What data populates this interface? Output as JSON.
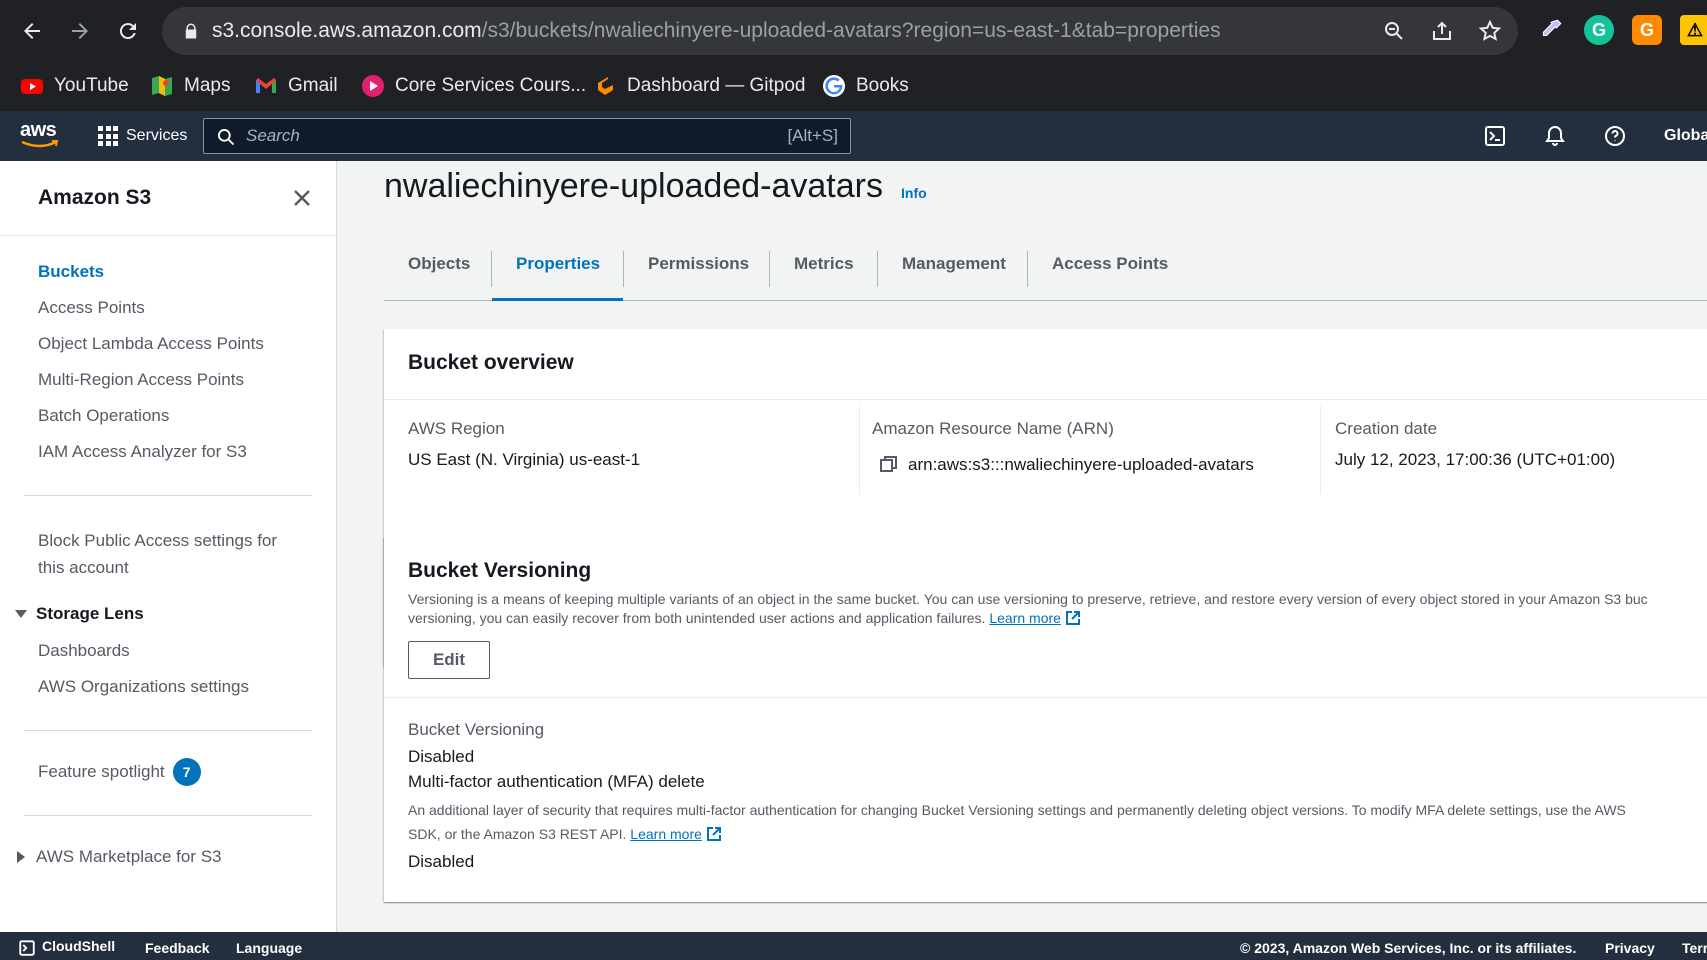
{
  "browser": {
    "url_host": "s3.console.aws.amazon.com",
    "url_path": "/s3/buckets/nwaliechinyere-uploaded-avatars?region=us-east-1&tab=properties",
    "bookmarks": [
      {
        "label": "YouTube",
        "icon": "youtube-icon"
      },
      {
        "label": "Maps",
        "icon": "maps-icon"
      },
      {
        "label": "Gmail",
        "icon": "gmail-icon"
      },
      {
        "label": "Core Services Cours...",
        "icon": "core-services-icon"
      },
      {
        "label": "Dashboard — Gitpod",
        "icon": "gitpod-icon"
      },
      {
        "label": "Books",
        "icon": "google-icon"
      }
    ]
  },
  "aws_nav": {
    "logo": "aws",
    "services_label": "Services",
    "search_placeholder": "Search",
    "search_shortcut": "[Alt+S]",
    "region": "Global"
  },
  "sidebar": {
    "title": "Amazon S3",
    "items": [
      {
        "label": "Buckets",
        "active": true
      },
      {
        "label": "Access Points"
      },
      {
        "label": "Object Lambda Access Points"
      },
      {
        "label": "Multi-Region Access Points"
      },
      {
        "label": "Batch Operations"
      },
      {
        "label": "IAM Access Analyzer for S3"
      }
    ],
    "block_public_access_line1": "Block Public Access settings for",
    "block_public_access_line2": "this account",
    "storage_lens": {
      "label": "Storage Lens",
      "items": [
        "Dashboards",
        "AWS Organizations settings"
      ]
    },
    "feature_spotlight": {
      "label": "Feature spotlight",
      "count": "7"
    },
    "marketplace": "AWS Marketplace for S3"
  },
  "main": {
    "bucket_name": "nwaliechinyere-uploaded-avatars",
    "info_label": "Info",
    "tabs": [
      {
        "label": "Objects"
      },
      {
        "label": "Properties",
        "active": true
      },
      {
        "label": "Permissions"
      },
      {
        "label": "Metrics"
      },
      {
        "label": "Management"
      },
      {
        "label": "Access Points"
      }
    ],
    "overview": {
      "title": "Bucket overview",
      "region_label": "AWS Region",
      "region_value": "US East (N. Virginia) us-east-1",
      "arn_label": "Amazon Resource Name (ARN)",
      "arn_value": "arn:aws:s3:::nwaliechinyere-uploaded-avatars",
      "created_label": "Creation date",
      "created_value": "July 12, 2023, 17:00:36 (UTC+01:00)"
    },
    "versioning": {
      "title": "Bucket Versioning",
      "desc_line1": "Versioning is a means of keeping multiple variants of an object in the same bucket. You can use versioning to preserve, retrieve, and restore every version of every object stored in your Amazon S3 buc",
      "desc_line2": "versioning, you can easily recover from both unintended user actions and application failures.",
      "learn_more": "Learn more",
      "edit_label": "Edit",
      "status_label": "Bucket Versioning",
      "status_value": "Disabled",
      "mfa_label": "Multi-factor authentication (MFA) delete",
      "mfa_desc_line1": "An additional layer of security that requires multi-factor authentication for changing Bucket Versioning settings and permanently deleting object versions. To modify MFA delete settings, use the AWS",
      "mfa_desc_line2": "SDK, or the Amazon S3 REST API.",
      "mfa_learn_more": "Learn more",
      "mfa_value": "Disabled"
    }
  },
  "footer": {
    "cloudshell": "CloudShell",
    "feedback": "Feedback",
    "language": "Language",
    "copyright": "© 2023, Amazon Web Services, Inc. or its affiliates.",
    "privacy": "Privacy",
    "terms": "Terr"
  },
  "colors": {
    "aws_nav_bg": "#232f3e",
    "link_blue": "#0073bb",
    "browser_bg": "#202124"
  }
}
